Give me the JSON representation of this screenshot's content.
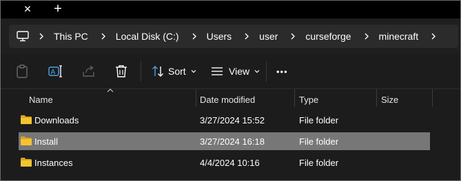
{
  "tabbar": {
    "close_glyph": "✕",
    "new_glyph": "+"
  },
  "breadcrumb": {
    "icon": "computer-icon",
    "items": [
      "This PC",
      "Local Disk (C:)",
      "Users",
      "user",
      "curseforge",
      "minecraft"
    ]
  },
  "toolbar": {
    "sort_label": "Sort",
    "view_label": "View",
    "more_glyph": "•••"
  },
  "columns": {
    "name": "Name",
    "date": "Date modified",
    "type": "Type",
    "size": "Size"
  },
  "rows": [
    {
      "name": "Downloads",
      "date": "3/27/2024 15:52",
      "type": "File folder",
      "size": "",
      "selected": false
    },
    {
      "name": "Install",
      "date": "3/27/2024 16:18",
      "type": "File folder",
      "size": "",
      "selected": true
    },
    {
      "name": "Instances",
      "date": "4/4/2024 10:16",
      "type": "File folder",
      "size": "",
      "selected": false
    }
  ],
  "colors": {
    "accent_blue": "#4aa3e6",
    "folder_yellow": "#f4c430",
    "selection": "#777777"
  }
}
